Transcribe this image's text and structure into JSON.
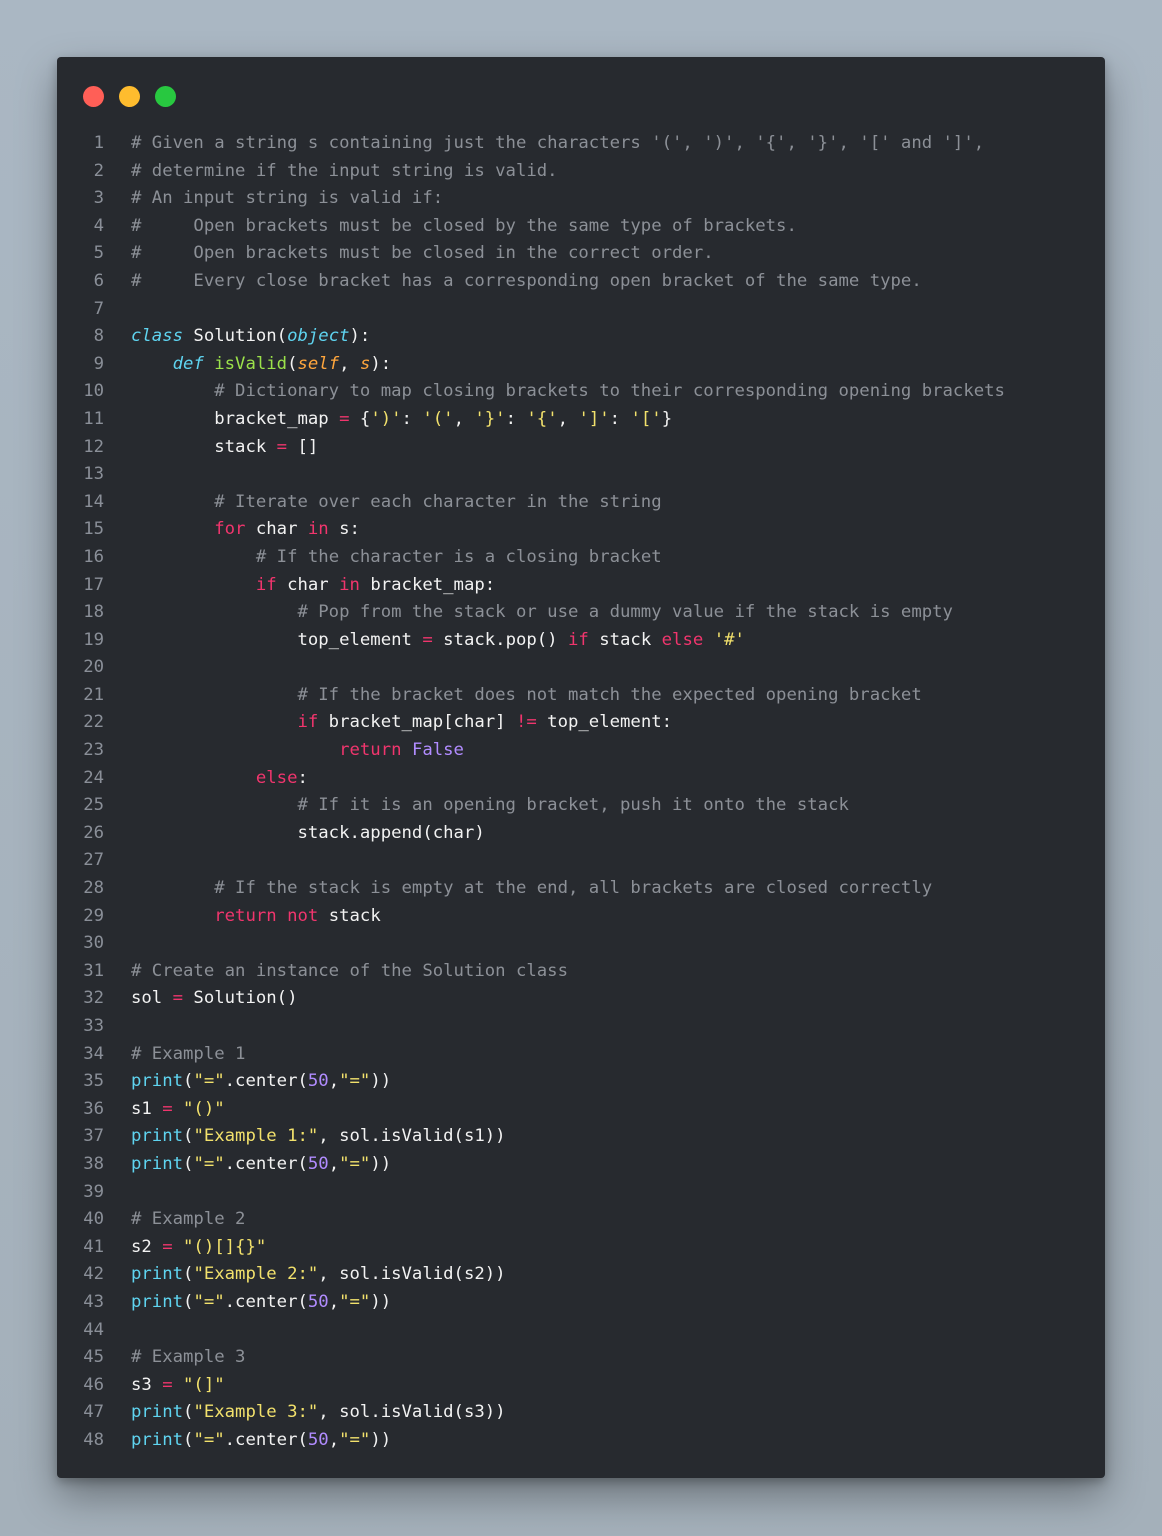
{
  "window": {
    "controls": [
      "close",
      "minimize",
      "maximize"
    ],
    "colors": {
      "close": "#ff5f57",
      "minimize": "#febc2e",
      "maximize": "#28c840",
      "background": "#272a2f"
    }
  },
  "editor": {
    "language": "python",
    "lines": [
      [
        [
          "comment",
          "# Given a string s containing just the characters '(', ')', '{', '}', '[' and ']',"
        ]
      ],
      [
        [
          "comment",
          "# determine if the input string is valid."
        ]
      ],
      [
        [
          "comment",
          "# An input string is valid if:"
        ]
      ],
      [
        [
          "comment",
          "#     Open brackets must be closed by the same type of brackets."
        ]
      ],
      [
        [
          "comment",
          "#     Open brackets must be closed in the correct order."
        ]
      ],
      [
        [
          "comment",
          "#     Every close bracket has a corresponding open bracket of the same type."
        ]
      ],
      [],
      [
        [
          "storage",
          "class"
        ],
        [
          "plain",
          " Solution("
        ],
        [
          "storage",
          "object"
        ],
        [
          "plain",
          "):"
        ]
      ],
      [
        [
          "plain",
          "    "
        ],
        [
          "storage",
          "def"
        ],
        [
          "plain",
          " "
        ],
        [
          "function",
          "isValid"
        ],
        [
          "plain",
          "("
        ],
        [
          "param",
          "self"
        ],
        [
          "plain",
          ", "
        ],
        [
          "param",
          "s"
        ],
        [
          "plain",
          "):"
        ]
      ],
      [
        [
          "plain",
          "        "
        ],
        [
          "comment",
          "# Dictionary to map closing brackets to their corresponding opening brackets"
        ]
      ],
      [
        [
          "plain",
          "        bracket_map "
        ],
        [
          "operator",
          "="
        ],
        [
          "plain",
          " {"
        ],
        [
          "string",
          "')'"
        ],
        [
          "plain",
          ": "
        ],
        [
          "string",
          "'('"
        ],
        [
          "plain",
          ", "
        ],
        [
          "string",
          "'}'"
        ],
        [
          "plain",
          ": "
        ],
        [
          "string",
          "'{'"
        ],
        [
          "plain",
          ", "
        ],
        [
          "string",
          "']'"
        ],
        [
          "plain",
          ": "
        ],
        [
          "string",
          "'['"
        ],
        [
          "plain",
          "}"
        ]
      ],
      [
        [
          "plain",
          "        stack "
        ],
        [
          "operator",
          "="
        ],
        [
          "plain",
          " []"
        ]
      ],
      [],
      [
        [
          "plain",
          "        "
        ],
        [
          "comment",
          "# Iterate over each character in the string"
        ]
      ],
      [
        [
          "plain",
          "        "
        ],
        [
          "keyword",
          "for"
        ],
        [
          "plain",
          " char "
        ],
        [
          "keyword",
          "in"
        ],
        [
          "plain",
          " s:"
        ]
      ],
      [
        [
          "plain",
          "            "
        ],
        [
          "comment",
          "# If the character is a closing bracket"
        ]
      ],
      [
        [
          "plain",
          "            "
        ],
        [
          "keyword",
          "if"
        ],
        [
          "plain",
          " char "
        ],
        [
          "keyword",
          "in"
        ],
        [
          "plain",
          " bracket_map:"
        ]
      ],
      [
        [
          "plain",
          "                "
        ],
        [
          "comment",
          "# Pop from the stack or use a dummy value if the stack is empty"
        ]
      ],
      [
        [
          "plain",
          "                top_element "
        ],
        [
          "operator",
          "="
        ],
        [
          "plain",
          " stack.pop() "
        ],
        [
          "keyword",
          "if"
        ],
        [
          "plain",
          " stack "
        ],
        [
          "keyword",
          "else"
        ],
        [
          "plain",
          " "
        ],
        [
          "string",
          "'#'"
        ]
      ],
      [],
      [
        [
          "plain",
          "                "
        ],
        [
          "comment",
          "# If the bracket does not match the expected opening bracket"
        ]
      ],
      [
        [
          "plain",
          "                "
        ],
        [
          "keyword",
          "if"
        ],
        [
          "plain",
          " bracket_map[char] "
        ],
        [
          "operator",
          "!="
        ],
        [
          "plain",
          " top_element:"
        ]
      ],
      [
        [
          "plain",
          "                    "
        ],
        [
          "keyword",
          "return"
        ],
        [
          "plain",
          " "
        ],
        [
          "constant",
          "False"
        ]
      ],
      [
        [
          "plain",
          "            "
        ],
        [
          "keyword",
          "else"
        ],
        [
          "plain",
          ":"
        ]
      ],
      [
        [
          "plain",
          "                "
        ],
        [
          "comment",
          "# If it is an opening bracket, push it onto the stack"
        ]
      ],
      [
        [
          "plain",
          "                stack.append(char)"
        ]
      ],
      [],
      [
        [
          "plain",
          "        "
        ],
        [
          "comment",
          "# If the stack is empty at the end, all brackets are closed correctly"
        ]
      ],
      [
        [
          "plain",
          "        "
        ],
        [
          "keyword",
          "return"
        ],
        [
          "plain",
          " "
        ],
        [
          "keyword",
          "not"
        ],
        [
          "plain",
          " stack"
        ]
      ],
      [],
      [
        [
          "comment",
          "# Create an instance of the Solution class"
        ]
      ],
      [
        [
          "plain",
          "sol "
        ],
        [
          "operator",
          "="
        ],
        [
          "plain",
          " Solution()"
        ]
      ],
      [],
      [
        [
          "comment",
          "# Example 1"
        ]
      ],
      [
        [
          "builtin",
          "print"
        ],
        [
          "plain",
          "("
        ],
        [
          "string",
          "\"=\""
        ],
        [
          "plain",
          ".center("
        ],
        [
          "number",
          "50"
        ],
        [
          "plain",
          ","
        ],
        [
          "string",
          "\"=\""
        ],
        [
          "plain",
          "))"
        ]
      ],
      [
        [
          "plain",
          "s1 "
        ],
        [
          "operator",
          "="
        ],
        [
          "plain",
          " "
        ],
        [
          "string",
          "\"()\""
        ]
      ],
      [
        [
          "builtin",
          "print"
        ],
        [
          "plain",
          "("
        ],
        [
          "string",
          "\"Example 1:\""
        ],
        [
          "plain",
          ", sol.isValid(s1))"
        ]
      ],
      [
        [
          "builtin",
          "print"
        ],
        [
          "plain",
          "("
        ],
        [
          "string",
          "\"=\""
        ],
        [
          "plain",
          ".center("
        ],
        [
          "number",
          "50"
        ],
        [
          "plain",
          ","
        ],
        [
          "string",
          "\"=\""
        ],
        [
          "plain",
          "))"
        ]
      ],
      [],
      [
        [
          "comment",
          "# Example 2"
        ]
      ],
      [
        [
          "plain",
          "s2 "
        ],
        [
          "operator",
          "="
        ],
        [
          "plain",
          " "
        ],
        [
          "string",
          "\"()[]{}\""
        ]
      ],
      [
        [
          "builtin",
          "print"
        ],
        [
          "plain",
          "("
        ],
        [
          "string",
          "\"Example 2:\""
        ],
        [
          "plain",
          ", sol.isValid(s2))"
        ]
      ],
      [
        [
          "builtin",
          "print"
        ],
        [
          "plain",
          "("
        ],
        [
          "string",
          "\"=\""
        ],
        [
          "plain",
          ".center("
        ],
        [
          "number",
          "50"
        ],
        [
          "plain",
          ","
        ],
        [
          "string",
          "\"=\""
        ],
        [
          "plain",
          "))"
        ]
      ],
      [],
      [
        [
          "comment",
          "# Example 3"
        ]
      ],
      [
        [
          "plain",
          "s3 "
        ],
        [
          "operator",
          "="
        ],
        [
          "plain",
          " "
        ],
        [
          "string",
          "\"(]\""
        ]
      ],
      [
        [
          "builtin",
          "print"
        ],
        [
          "plain",
          "("
        ],
        [
          "string",
          "\"Example 3:\""
        ],
        [
          "plain",
          ", sol.isValid(s3))"
        ]
      ],
      [
        [
          "builtin",
          "print"
        ],
        [
          "plain",
          "("
        ],
        [
          "string",
          "\"=\""
        ],
        [
          "plain",
          ".center("
        ],
        [
          "number",
          "50"
        ],
        [
          "plain",
          ","
        ],
        [
          "string",
          "\"=\""
        ],
        [
          "plain",
          "))"
        ]
      ]
    ]
  }
}
